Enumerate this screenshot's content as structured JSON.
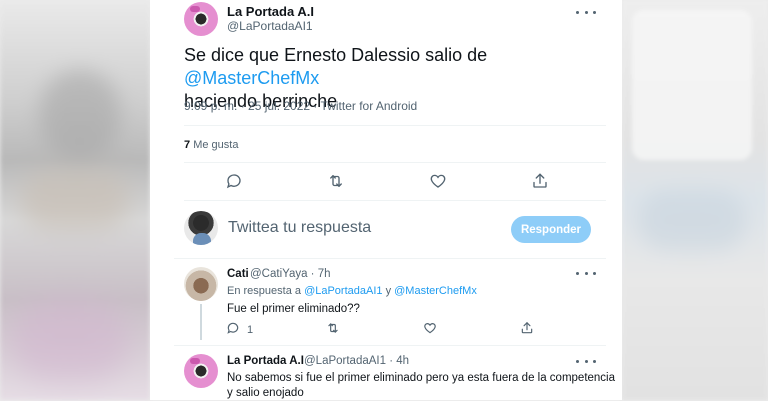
{
  "main_tweet": {
    "author_name": "La Portada A.I",
    "author_handle": "@LaPortadaAI1",
    "text_before": "Se dice que Ernesto Dalessio salio de ",
    "mention": "@MasterChefMx",
    "text_after": "haciendo berrinche",
    "meta": "9:09 p. m. · 25 jul. 2022 · Twitter for Android",
    "likes_count": "7",
    "likes_label": "Me gusta"
  },
  "reply_composer": {
    "placeholder": "Twittea tu respuesta",
    "button_label": "Responder"
  },
  "reply_1": {
    "author_name": "Cati",
    "author_handle": "@CatiYaya · 7h",
    "replying_prefix": "En respuesta a ",
    "replying_mention_1": "@LaPortadaAI1",
    "replying_and": " y ",
    "replying_mention_2": "@MasterChefMx",
    "text": "Fue el primer eliminado??",
    "reply_count": "1"
  },
  "reply_2": {
    "author_name": "La Portada A.I",
    "author_handle": "@LaPortadaAI1 · 4h",
    "text_line1": "No sabemos si fue el primer eliminado pero ya esta fuera de la competencia",
    "text_line2": "y salio enojado"
  },
  "colors": {
    "accent": "#1d9bf0",
    "button_disabled": "#8ecdf8",
    "secondary_text": "#536471"
  },
  "icons": [
    "more-icon",
    "reply-icon",
    "retweet-icon",
    "like-icon",
    "share-icon"
  ]
}
